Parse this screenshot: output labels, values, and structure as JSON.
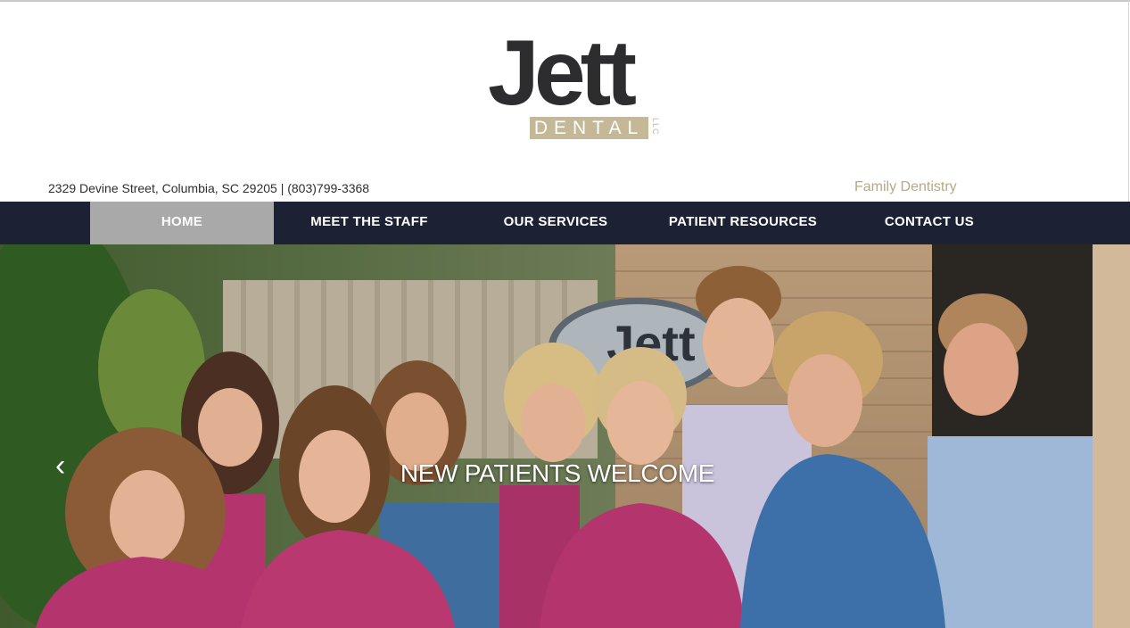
{
  "brand": {
    "logo_word": "Jett",
    "logo_sub": "DENTAL",
    "logo_llc": "LLC"
  },
  "header": {
    "address": "2329 Devine Street, Columbia, SC 29205 | (803)799-3368",
    "tagline": "Family Dentistry"
  },
  "nav": {
    "items": [
      {
        "label": "HOME",
        "active": true
      },
      {
        "label": "MEET THE STAFF"
      },
      {
        "label": "OUR SERVICES"
      },
      {
        "label": "PATIENT RESOURCES"
      },
      {
        "label": "CONTACT US"
      }
    ]
  },
  "hero": {
    "caption": "NEW PATIENTS WELCOME",
    "prev_icon": "chevron-left-icon",
    "sign_text": "Jett"
  },
  "colors": {
    "nav_bg": "#1c2233",
    "nav_active": "#a9a9a9",
    "brand_gold": "#c5b896",
    "scrubs": "#b4356e",
    "denim": "#3a6ea5"
  }
}
